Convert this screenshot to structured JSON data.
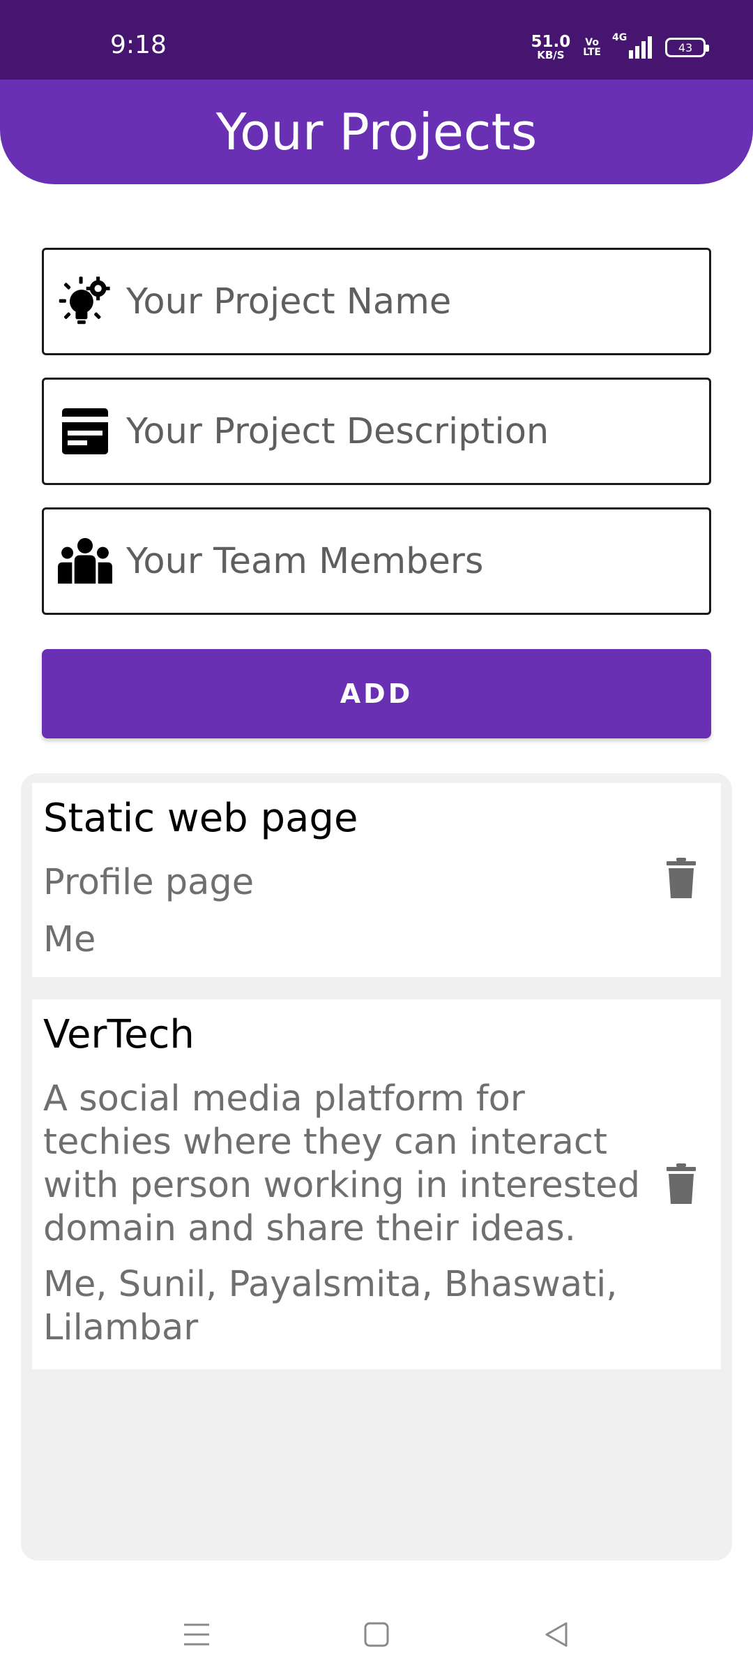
{
  "status_bar": {
    "time": "9:18",
    "net_speed": "51.0",
    "net_unit": "KB/S",
    "volte_top": "Vo",
    "volte_bottom": "LTE",
    "network": "4G",
    "battery": "43"
  },
  "header": {
    "title": "Your Projects"
  },
  "form": {
    "name_placeholder": "Your Project Name",
    "name_icon": "lightbulb-gear-icon",
    "description_placeholder": "Your Project Description",
    "description_icon": "card-icon",
    "team_placeholder": "Your Team Members",
    "team_icon": "group-icon",
    "add_label": "ADD"
  },
  "projects": [
    {
      "title": "Static web page",
      "description": "Profile page",
      "team": "Me"
    },
    {
      "title": "VerTech",
      "description": "A social media platform for techies where they can interact with person working in interested domain and share their ideas.",
      "team": "Me, Sunil, Payalsmita, Bhaswati, Lilambar"
    }
  ],
  "colors": {
    "status_bar": "#45156f",
    "primary": "#6a30b3",
    "panel_bg": "#f0f0f0",
    "secondary_text": "#6f6f6f"
  }
}
